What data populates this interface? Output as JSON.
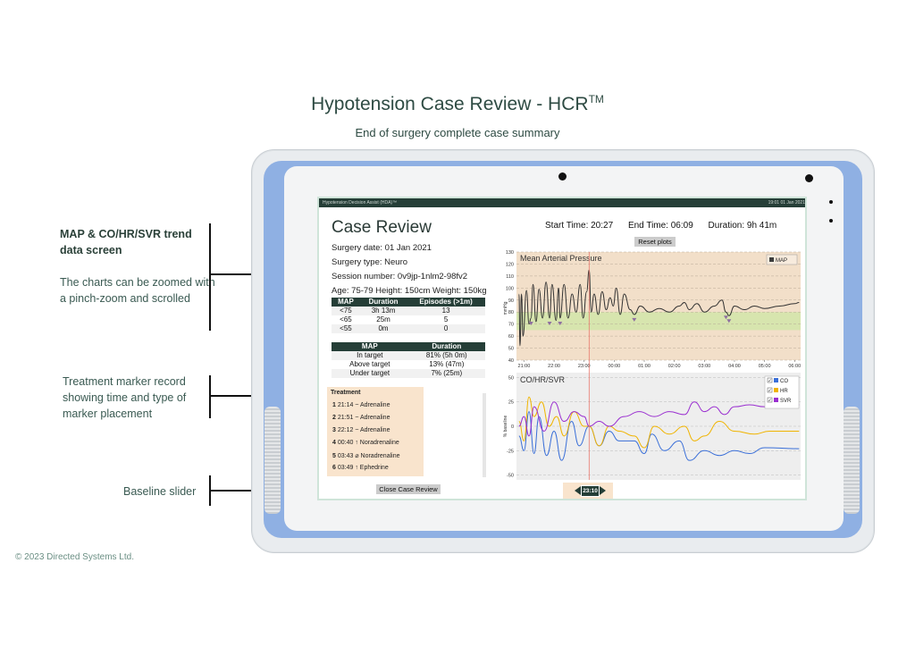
{
  "header": {
    "title": "Hypotension Case Review - HCR",
    "title_sup": "TM",
    "subtitle": "End of surgery complete case summary"
  },
  "annotations": {
    "map_heading": "MAP & CO/HR/SVR trend data screen",
    "map_body": "The charts can be zoomed with a pinch-zoom and scrolled",
    "treatment": "Treatment marker record showing time and type of marker placement",
    "baseline": "Baseline slider"
  },
  "copyright": "© 2023 Directed Systems Ltd.",
  "app": {
    "status_title": "Hypotension Decision Assist (HDA)™",
    "status_time": "19:01    01 Jan 2021",
    "case_title": "Case Review",
    "surgery_date": "Surgery date: 01 Jan 2021",
    "surgery_type": "Surgery type: Neuro",
    "session_number": "Session number: 0v9jp-1nlm2-98fv2",
    "demographics": "Age: 75-79 Height: 150cm  Weight: 150kg",
    "start_time": "Start Time: 20:27",
    "end_time": "End Time: 06:09",
    "duration": "Duration: 9h 41m",
    "reset_button": "Reset plots",
    "close_button": "Close Case Review",
    "slider_value": "23:10",
    "episodes_table": {
      "headers": [
        "MAP",
        "Duration",
        "Episodes (>1m)"
      ],
      "rows": [
        [
          "<75",
          "3h 13m",
          "13"
        ],
        [
          "<65",
          "25m",
          "5"
        ],
        [
          "<55",
          "0m",
          "0"
        ]
      ]
    },
    "target_table": {
      "headers": [
        "MAP",
        "Duration"
      ],
      "rows": [
        [
          "In target",
          "81% (5h 0m)"
        ],
        [
          "Above target",
          "13% (47m)"
        ],
        [
          "Under target",
          "7% (25m)"
        ]
      ]
    },
    "treatment": {
      "title": "Treatment",
      "items": [
        {
          "n": "1",
          "time": "21:14",
          "icon": "~",
          "drug": "Adrenaline"
        },
        {
          "n": "2",
          "time": "21:51",
          "icon": "~",
          "drug": "Adrenaline"
        },
        {
          "n": "3",
          "time": "22:12",
          "icon": "~",
          "drug": "Adrenaline"
        },
        {
          "n": "4",
          "time": "00:40",
          "icon": "↑",
          "drug": "Noradrenaline"
        },
        {
          "n": "5",
          "time": "03:43",
          "icon": "⌀",
          "drug": "Noradrenaline"
        },
        {
          "n": "6",
          "time": "03:49",
          "icon": "↑",
          "drug": "Ephedrine"
        }
      ]
    }
  },
  "colors": {
    "dark_green": "#253e37",
    "map_bg": "#f2dfc9",
    "target_band": "#cfe6a8",
    "co": "#3a6fd8",
    "hr": "#f0b400",
    "svr": "#9a2fd0",
    "marker_line": "#e87a6e"
  },
  "chart_data": [
    {
      "type": "line",
      "title": "Mean Arterial Pressure",
      "ylabel": "mmHg",
      "x_ticks": [
        "21:00",
        "22:00",
        "23:00",
        "00:00",
        "01:00",
        "02:00",
        "03:00",
        "04:00",
        "05:00",
        "06:00"
      ],
      "y_ticks": [
        40,
        50,
        60,
        70,
        80,
        90,
        100,
        110,
        120,
        130
      ],
      "ylim": [
        40,
        130
      ],
      "target_band": [
        65,
        80
      ],
      "legend": [
        "MAP"
      ],
      "series": [
        {
          "name": "MAP",
          "points": [
            [
              "20:50",
              95
            ],
            [
              "20:52",
              52
            ],
            [
              "20:55",
              95
            ],
            [
              "20:58",
              60
            ],
            [
              "21:05",
              98
            ],
            [
              "21:10",
              70
            ],
            [
              "21:14",
              75
            ],
            [
              "21:18",
              103
            ],
            [
              "21:24",
              72
            ],
            [
              "21:30",
              99
            ],
            [
              "21:37",
              75
            ],
            [
              "21:44",
              105
            ],
            [
              "21:51",
              75
            ],
            [
              "21:56",
              103
            ],
            [
              "22:04",
              73
            ],
            [
              "22:09",
              100
            ],
            [
              "22:12",
              75
            ],
            [
              "22:20",
              103
            ],
            [
              "22:28",
              75
            ],
            [
              "22:36",
              95
            ],
            [
              "22:44",
              80
            ],
            [
              "22:52",
              103
            ],
            [
              "22:58",
              75
            ],
            [
              "23:05",
              97
            ],
            [
              "23:10",
              115
            ],
            [
              "23:14",
              80
            ],
            [
              "23:20",
              95
            ],
            [
              "23:28",
              78
            ],
            [
              "23:36",
              97
            ],
            [
              "23:44",
              82
            ],
            [
              "23:52",
              92
            ],
            [
              "23:58",
              85
            ],
            [
              "00:04",
              100
            ],
            [
              "00:12",
              78
            ],
            [
              "00:20",
              95
            ],
            [
              "00:32",
              82
            ],
            [
              "00:40",
              78
            ],
            [
              "00:52",
              85
            ],
            [
              "01:10",
              80
            ],
            [
              "01:30",
              83
            ],
            [
              "01:50",
              80
            ],
            [
              "02:10",
              85
            ],
            [
              "02:20",
              88
            ],
            [
              "02:30",
              82
            ],
            [
              "02:45",
              87
            ],
            [
              "03:00",
              80
            ],
            [
              "03:20",
              85
            ],
            [
              "03:35",
              90
            ],
            [
              "03:43",
              80
            ],
            [
              "03:49",
              77
            ],
            [
              "04:00",
              85
            ],
            [
              "04:20",
              82
            ],
            [
              "04:40",
              85
            ],
            [
              "05:00",
              83
            ],
            [
              "05:30",
              85
            ],
            [
              "06:00",
              87
            ],
            [
              "06:09",
              88
            ]
          ]
        }
      ]
    },
    {
      "type": "line",
      "title": "CO/HR/SVR",
      "ylabel": "% baseline",
      "y_ticks": [
        -50,
        -25,
        0,
        25,
        50
      ],
      "ylim": [
        -55,
        55
      ],
      "legend": [
        "CO",
        "HR",
        "SVR"
      ],
      "series": [
        {
          "name": "CO",
          "points": [
            [
              "20:50",
              -10
            ],
            [
              "21:00",
              -25
            ],
            [
              "21:10",
              15
            ],
            [
              "21:20",
              -28
            ],
            [
              "21:30",
              10
            ],
            [
              "21:45",
              -30
            ],
            [
              "22:00",
              -5
            ],
            [
              "22:15",
              -35
            ],
            [
              "22:35",
              5
            ],
            [
              "22:50",
              -20
            ],
            [
              "23:10",
              0
            ],
            [
              "23:30",
              -20
            ],
            [
              "23:50",
              -5
            ],
            [
              "00:10",
              -15
            ],
            [
              "00:40",
              -15
            ],
            [
              "01:00",
              -28
            ],
            [
              "01:15",
              -8
            ],
            [
              "01:40",
              -25
            ],
            [
              "02:10",
              -15
            ],
            [
              "02:30",
              -35
            ],
            [
              "03:00",
              -25
            ],
            [
              "03:30",
              -30
            ],
            [
              "04:00",
              -25
            ],
            [
              "04:30",
              -28
            ],
            [
              "05:00",
              -22
            ],
            [
              "06:09",
              -23
            ]
          ]
        },
        {
          "name": "HR",
          "points": [
            [
              "20:50",
              5
            ],
            [
              "21:00",
              -15
            ],
            [
              "21:10",
              30
            ],
            [
              "21:20",
              10
            ],
            [
              "21:35",
              25
            ],
            [
              "21:50",
              0
            ],
            [
              "22:05",
              10
            ],
            [
              "22:20",
              -10
            ],
            [
              "22:40",
              15
            ],
            [
              "23:00",
              0
            ],
            [
              "23:10",
              0
            ],
            [
              "23:30",
              -20
            ],
            [
              "23:50",
              0
            ],
            [
              "00:10",
              -5
            ],
            [
              "00:40",
              -10
            ],
            [
              "01:00",
              -22
            ],
            [
              "01:20",
              0
            ],
            [
              "01:50",
              -8
            ],
            [
              "02:20",
              0
            ],
            [
              "02:40",
              -15
            ],
            [
              "03:00",
              -10
            ],
            [
              "03:30",
              5
            ],
            [
              "04:00",
              -5
            ],
            [
              "04:40",
              -8
            ],
            [
              "05:10",
              -5
            ],
            [
              "06:09",
              -5
            ]
          ]
        },
        {
          "name": "SVR",
          "points": [
            [
              "20:50",
              0
            ],
            [
              "21:00",
              10
            ],
            [
              "21:10",
              -10
            ],
            [
              "21:20",
              20
            ],
            [
              "21:40",
              -5
            ],
            [
              "22:00",
              25
            ],
            [
              "22:20",
              5
            ],
            [
              "22:40",
              15
            ],
            [
              "23:00",
              10
            ],
            [
              "23:10",
              0
            ],
            [
              "23:30",
              5
            ],
            [
              "23:50",
              0
            ],
            [
              "00:20",
              10
            ],
            [
              "00:50",
              15
            ],
            [
              "01:20",
              10
            ],
            [
              "01:50",
              15
            ],
            [
              "02:20",
              12
            ],
            [
              "02:40",
              25
            ],
            [
              "03:00",
              15
            ],
            [
              "03:20",
              20
            ],
            [
              "03:40",
              12
            ],
            [
              "04:00",
              20
            ],
            [
              "04:30",
              22
            ],
            [
              "05:00",
              20
            ],
            [
              "06:09",
              22
            ]
          ]
        }
      ]
    }
  ]
}
